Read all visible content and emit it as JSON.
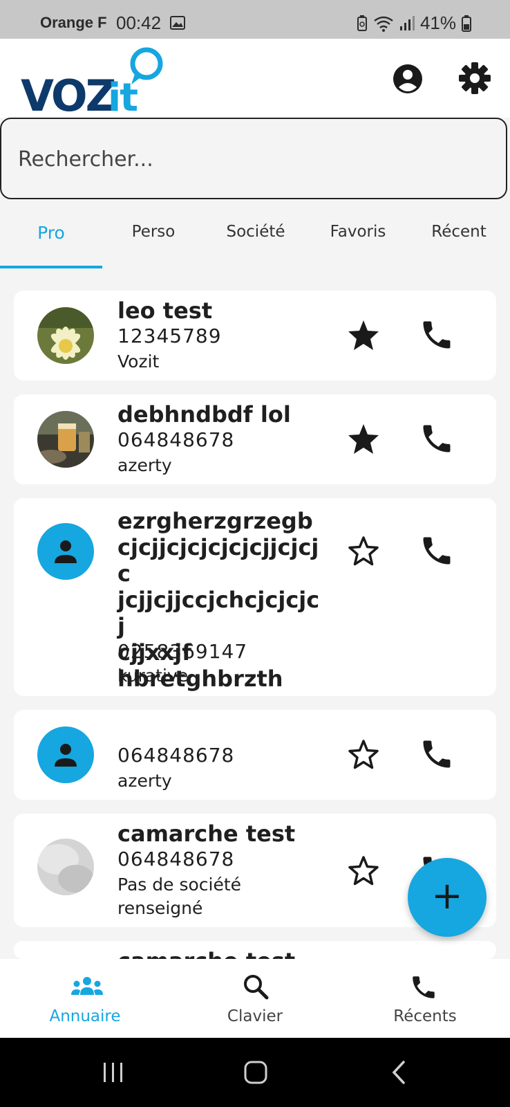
{
  "status_bar": {
    "carrier": "Orange F",
    "time": "00:42",
    "battery": "41%"
  },
  "app": {
    "logo_text": "VOZit"
  },
  "search": {
    "placeholder": "Rechercher..."
  },
  "tabs": [
    {
      "label": "Pro",
      "active": true
    },
    {
      "label": "Perso"
    },
    {
      "label": "Société"
    },
    {
      "label": "Favoris"
    },
    {
      "label": "Récent"
    }
  ],
  "contacts": [
    {
      "name": "leo test",
      "phone": "12345789",
      "company": "Vozit",
      "favorite": true,
      "avatar": "photo-flower"
    },
    {
      "name": "debhndbdf lol",
      "phone": "064848678",
      "company": "azerty",
      "favorite": true,
      "avatar": "photo-drink"
    },
    {
      "name": "ezrgherzgrzegbcjcjjcjcjcjcjcjjcjcjcjcjjcjjccjchcjcjcjcjcjjxxjfhbretghbrzth",
      "name_lines": [
        "ezrgherzgrzegb",
        "cjcjjcjcjcjcjcjjcjcjc",
        "jcjjcjjccjchcjcjcjcj",
        "cjjxxjf",
        "hbretghbrzth"
      ],
      "phone": "0258369147",
      "company": "kurative",
      "favorite": false,
      "avatar": "default"
    },
    {
      "name": "",
      "phone": "064848678",
      "company": "azerty",
      "favorite": false,
      "avatar": "default"
    },
    {
      "name": "camarche test",
      "phone": "064848678",
      "company": "Pas de société renseigné",
      "company_lines": [
        "Pas de société",
        "renseigné"
      ],
      "favorite": false,
      "avatar": "photo-blur"
    },
    {
      "name": "camarche test",
      "partially_visible": true
    }
  ],
  "fab": {
    "label": "+"
  },
  "bottom_nav": [
    {
      "label": "Annuaire",
      "icon": "group-icon",
      "active": true
    },
    {
      "label": "Clavier",
      "icon": "search-icon"
    },
    {
      "label": "Récents",
      "icon": "phone-icon"
    }
  ],
  "colors": {
    "accent": "#16a6e0",
    "logo_dark": "#0e3a6b"
  }
}
